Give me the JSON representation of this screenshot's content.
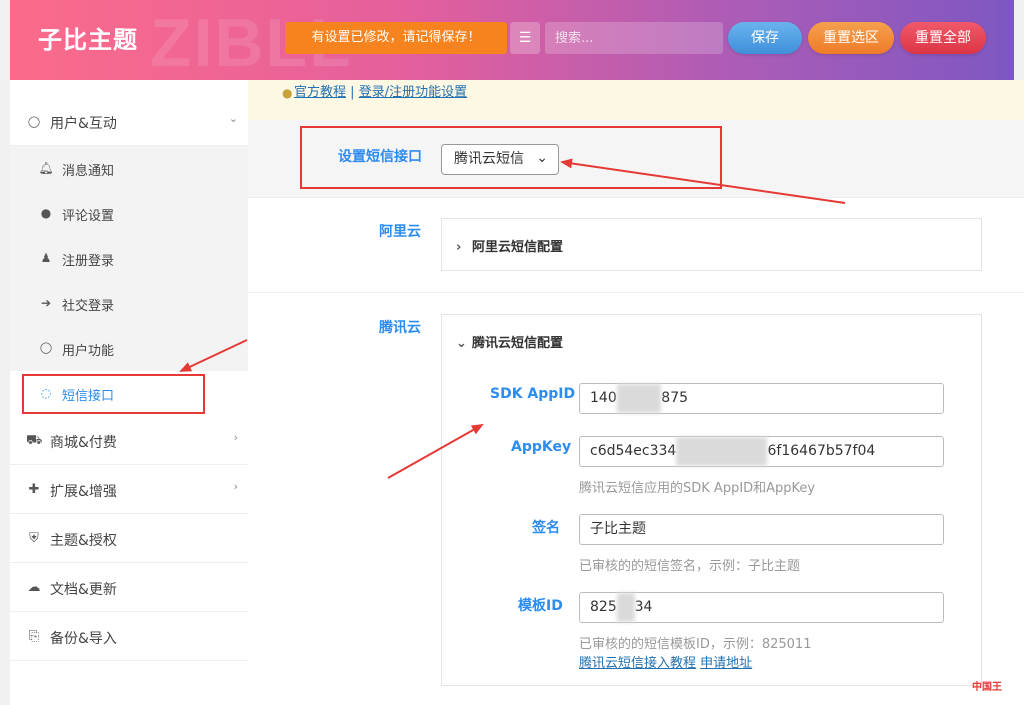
{
  "header": {
    "brand": "子比主题",
    "watermark": "ZIBLL",
    "notice": "有设置已修改，请记得保存！",
    "search_placeholder": "搜索...",
    "buttons": {
      "save": "保存",
      "reset_section": "重置选区",
      "reset_all": "重置全部"
    },
    "colors": {
      "notice": "#f7831f",
      "save": "#3f8fd9",
      "reset_section": "#ef7b28",
      "reset_all": "#dc3545"
    }
  },
  "sidebar": {
    "groups": [
      {
        "label": "用户&互动",
        "icon": "user-icon",
        "glyph": "👤",
        "expanded": true
      },
      {
        "label": "商城&付费",
        "icon": "cart-icon",
        "glyph": "🛒"
      },
      {
        "label": "扩展&增强",
        "icon": "puzzle-icon",
        "glyph": "🧩"
      },
      {
        "label": "主题&授权",
        "icon": "shield-icon",
        "glyph": "⛨"
      },
      {
        "label": "文档&更新",
        "icon": "cloud-download-icon",
        "glyph": "☁"
      },
      {
        "label": "备份&导入",
        "icon": "copy-icon",
        "glyph": "⎘"
      }
    ],
    "subitems": [
      {
        "label": "消息通知",
        "icon": "bell-icon",
        "glyph": "🔔"
      },
      {
        "label": "评论设置",
        "icon": "comments-icon",
        "glyph": "💬"
      },
      {
        "label": "注册登录",
        "icon": "user-plus-icon",
        "glyph": "👤"
      },
      {
        "label": "社交登录",
        "icon": "sign-in-icon",
        "glyph": "➜"
      },
      {
        "label": "用户功能",
        "icon": "user-icon",
        "glyph": "👤"
      },
      {
        "label": "短信接口",
        "icon": "chat-icon",
        "glyph": "🗨",
        "active": true
      }
    ]
  },
  "main": {
    "links": {
      "tutorial": "官方教程",
      "separator": "|",
      "login_settings": "登录/注册功能设置"
    },
    "sms_interface": {
      "label": "设置短信接口",
      "selected": "腾讯云短信"
    },
    "aliyun": {
      "label": "阿里云",
      "accordion": "阿里云短信配置"
    },
    "tencent": {
      "label": "腾讯云",
      "accordion": "腾讯云短信配置",
      "sdk_appid": {
        "label": "SDK AppID",
        "value_start": "140",
        "value_blur": "00000",
        "value_end": "875"
      },
      "appkey": {
        "label": "AppKey",
        "value_start": "c6d54ec334",
        "value_blur": "xxxxxxxxxxx",
        "value_end": "6f16467b57f04",
        "desc": "腾讯云短信应用的SDK AppID和AppKey"
      },
      "sign": {
        "label": "签名",
        "value": "子比主题",
        "desc": "已审核的的短信签名，示例：子比主题"
      },
      "template": {
        "label": "模板ID",
        "value_start": "825",
        "value_blur": "00",
        "value_end": "34",
        "desc": "已审核的的短信模板ID，示例：825011",
        "link1": "腾讯云短信接入教程",
        "link2": "申请地址"
      }
    }
  },
  "corner_logo": "中国王"
}
